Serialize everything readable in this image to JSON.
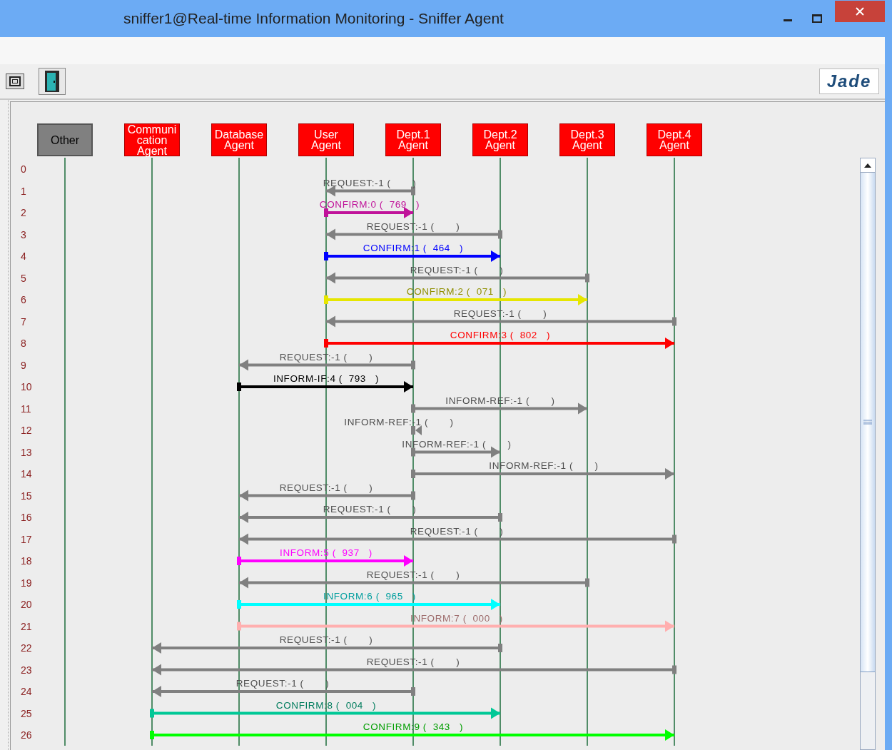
{
  "window": {
    "title": "sniffer1@Real-time Information Monitoring - Sniffer Agent"
  },
  "toolbar": {
    "logo_text": "Jade"
  },
  "agents": [
    {
      "name": "Other",
      "kind": "other"
    },
    {
      "name": "Communication Agent",
      "kind": "agent"
    },
    {
      "name": "Database Agent",
      "kind": "agent"
    },
    {
      "name": "User Agent",
      "kind": "agent"
    },
    {
      "name": "Dept.1 Agent",
      "kind": "agent"
    },
    {
      "name": "Dept.2 Agent",
      "kind": "agent"
    },
    {
      "name": "Dept.3 Agent",
      "kind": "agent"
    },
    {
      "name": "Dept.4 Agent",
      "kind": "agent"
    }
  ],
  "row_numbers": [
    "0",
    "1",
    "2",
    "3",
    "4",
    "5",
    "6",
    "7",
    "8",
    "9",
    "10",
    "11",
    "12",
    "13",
    "14",
    "15",
    "16",
    "17",
    "18",
    "19",
    "20",
    "21",
    "22",
    "23",
    "24",
    "25",
    "26"
  ],
  "messages": [
    {
      "label": "REQUEST:-1 (       )",
      "color": "#808080"
    },
    {
      "label": "CONFIRM:0 (  769   )",
      "color": "#c0139a"
    },
    {
      "label": "REQUEST:-1 (       )",
      "color": "#808080"
    },
    {
      "label": "CONFIRM:1 (  464   )",
      "color": "#0000ff"
    },
    {
      "label": "REQUEST:-1 (       )",
      "color": "#808080"
    },
    {
      "label": "CONFIRM:2 (  071   )",
      "color": "#e6e600"
    },
    {
      "label": "REQUEST:-1 (       )",
      "color": "#808080"
    },
    {
      "label": "CONFIRM:3 (  802   )",
      "color": "#ff0000"
    },
    {
      "label": "REQUEST:-1 (       )",
      "color": "#808080"
    },
    {
      "label": "INFORM-IF:4 (  793   )",
      "color": "#000000"
    },
    {
      "label": "INFORM-REF:-1 (       )",
      "color": "#808080"
    },
    {
      "label": "INFORM-REF:-1 (       )",
      "color": "#808080"
    },
    {
      "label": "INFORM-REF:-1 (       )",
      "color": "#808080"
    },
    {
      "label": "INFORM-REF:-1 (       )",
      "color": "#808080"
    },
    {
      "label": "REQUEST:-1 (       )",
      "color": "#808080"
    },
    {
      "label": "REQUEST:-1 (       )",
      "color": "#808080"
    },
    {
      "label": "REQUEST:-1 (       )",
      "color": "#808080"
    },
    {
      "label": "INFORM:5 (  937   )",
      "color": "#ff00ff"
    },
    {
      "label": "REQUEST:-1 (       )",
      "color": "#808080"
    },
    {
      "label": "INFORM:6 (  965   )",
      "color": "#00ffff"
    },
    {
      "label": "INFORM:7 (  000   )",
      "color": "#ffafaf"
    },
    {
      "label": "REQUEST:-1 (       )",
      "color": "#808080"
    },
    {
      "label": "REQUEST:-1 (       )",
      "color": "#808080"
    },
    {
      "label": "REQUEST:-1 (       )",
      "color": "#808080"
    },
    {
      "label": "CONFIRM:8 (  004   )",
      "color": "#00c896"
    },
    {
      "label": "CONFIRM:9 (  343   )",
      "color": "#00ff00"
    }
  ]
}
